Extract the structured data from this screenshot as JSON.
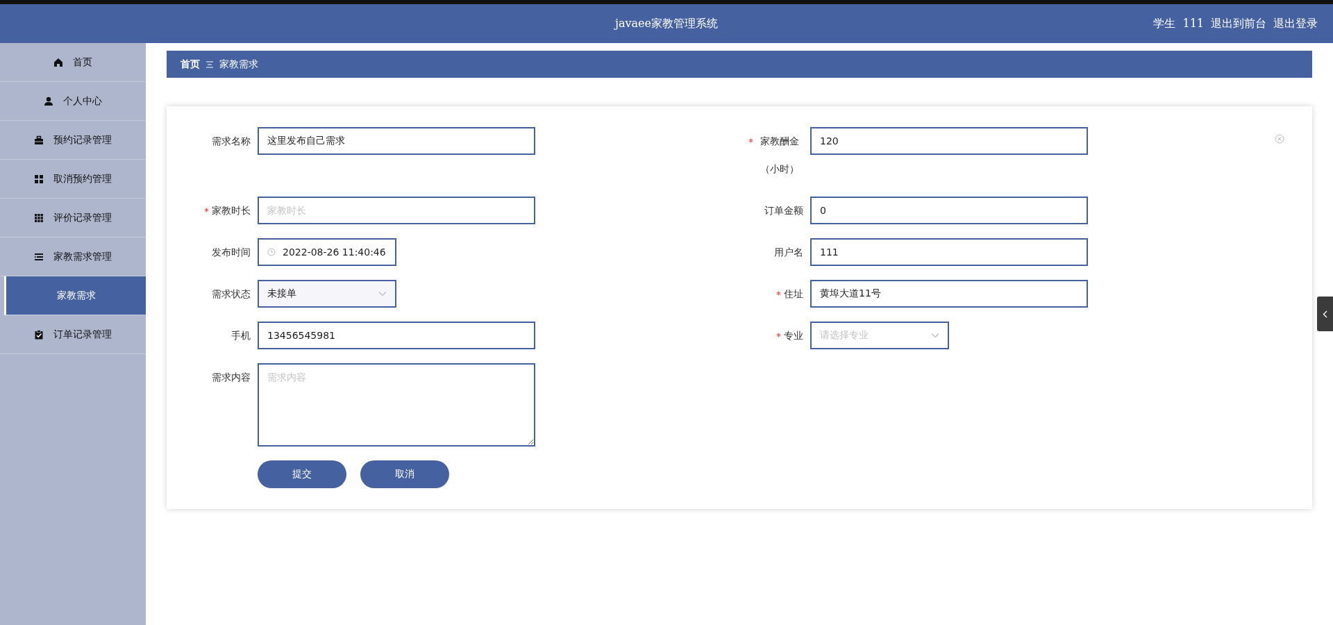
{
  "header": {
    "title": "javaee家教管理系统",
    "user_role": "学生",
    "user_name": "111",
    "links": [
      "退出到前台",
      "退出登录"
    ]
  },
  "sidebar": {
    "items": [
      {
        "label": "首页",
        "selected": false
      },
      {
        "label": "个人中心",
        "selected": false
      },
      {
        "label": "预约记录管理",
        "selected": false
      },
      {
        "label": "取消预约管理",
        "selected": false
      },
      {
        "label": "评价记录管理",
        "selected": false
      },
      {
        "label": "家教需求管理",
        "selected": false,
        "expanded": true,
        "children": [
          {
            "label": "家教需求",
            "selected": true
          }
        ]
      },
      {
        "label": "订单记录管理",
        "selected": false
      }
    ]
  },
  "breadcrumb": [
    "首页",
    "家教需求"
  ],
  "form": {
    "fields": [
      {
        "label": "需求名称",
        "required": false,
        "kind": "text",
        "value": "这里发布自己需求"
      },
      {
        "label": "家教酬金（小时）",
        "required": true,
        "kind": "text",
        "value": "120"
      },
      {
        "label": "家教时长",
        "required": true,
        "kind": "text",
        "placeholder": "家教时长"
      },
      {
        "label": "订单金额",
        "required": false,
        "kind": "text",
        "value": "0"
      },
      {
        "label": "发布时间",
        "required": false,
        "kind": "date",
        "value": "2022-08-26 11:40:46"
      },
      {
        "label": "用户名",
        "required": false,
        "kind": "text",
        "value": "111"
      },
      {
        "label": "需求状态",
        "required": false,
        "kind": "select",
        "value": "未接单"
      },
      {
        "label": "住址",
        "required": true,
        "kind": "text",
        "value": "黄埠大道11号"
      },
      {
        "label": "手机",
        "required": false,
        "kind": "text",
        "value": "13456545981"
      },
      {
        "label": "专业",
        "required": true,
        "kind": "select",
        "placeholder": "请选择专业"
      },
      {
        "label": "需求内容",
        "required": false,
        "kind": "textarea",
        "placeholder": "需求内容"
      }
    ],
    "buttons": [
      "提交",
      "取消"
    ]
  }
}
